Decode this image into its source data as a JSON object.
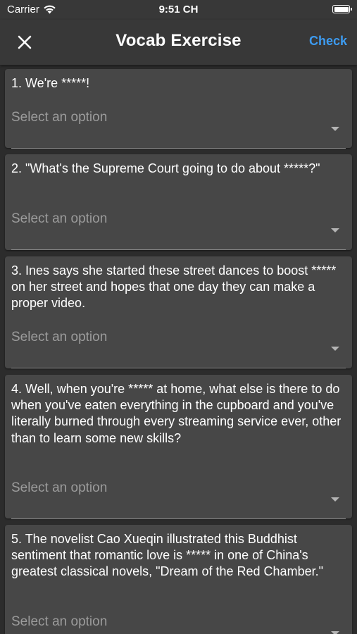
{
  "status": {
    "carrier": "Carrier",
    "time": "9:51 CH"
  },
  "nav": {
    "title": "Vocab Exercise",
    "check_label": "Check"
  },
  "placeholder": "Select an option",
  "questions": [
    {
      "text": "1. We're *****!",
      "placeholder": "Select an option"
    },
    {
      "text": "2. \"What's the Supreme Court going to do about *****?\"",
      "placeholder": "Select an option"
    },
    {
      "text": "3. Ines says she started these street dances to boost ***** on her street and hopes that one day they can make a proper video.",
      "placeholder": "Select an option"
    },
    {
      "text": "4. Well, when you're ***** at home, what else is there to do when you've eaten everything in the cupboard and you've literally burned through every streaming service ever, other than to learn some new skills?",
      "placeholder": "Select an option"
    },
    {
      "text": "5. The novelist Cao Xueqin illustrated this Buddhist sentiment that romantic love is ***** in one of China's greatest classical novels, \"Dream of the Red Chamber.\"",
      "placeholder": "Select an option"
    }
  ],
  "colors": {
    "background": "#2c2c2c",
    "bar": "#383838",
    "card": "#474747",
    "accent": "#3d9bf0",
    "placeholder": "#9c9c9c"
  }
}
